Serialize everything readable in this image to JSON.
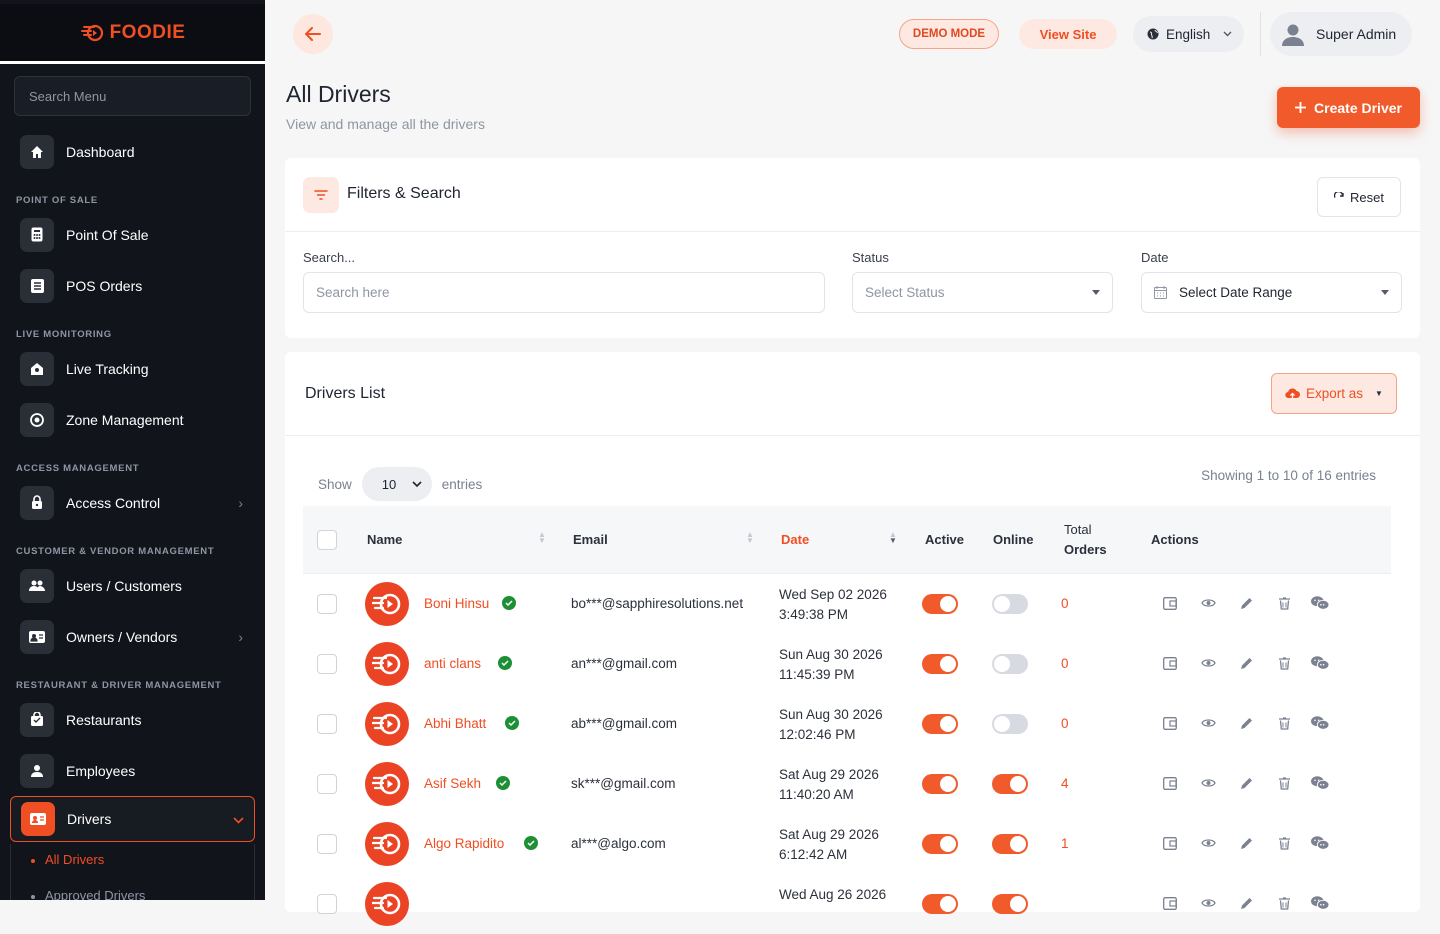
{
  "brand": {
    "name": "FOODIE",
    "color": "#f04e23"
  },
  "sidebar": {
    "search_placeholder": "Search Menu",
    "dashboard": "Dashboard",
    "sections": {
      "pos": "POINT OF SALE",
      "live": "LIVE MONITORING",
      "access": "ACCESS MANAGEMENT",
      "customer": "CUSTOMER & VENDOR MANAGEMENT",
      "restaurant": "RESTAURANT & DRIVER MANAGEMENT"
    },
    "items": {
      "point_of_sale": "Point Of Sale",
      "pos_orders": "POS Orders",
      "live_tracking": "Live Tracking",
      "zone_management": "Zone Management",
      "access_control": "Access Control",
      "users_customers": "Users / Customers",
      "owners_vendors": "Owners / Vendors",
      "restaurants": "Restaurants",
      "employees": "Employees",
      "drivers": "Drivers"
    },
    "drivers_sub": {
      "all": "All Drivers",
      "approved": "Approved Drivers"
    }
  },
  "header": {
    "demo_mode": "DEMO MODE",
    "view_site": "View Site",
    "language": "English",
    "user": "Super Admin"
  },
  "page": {
    "title": "All Drivers",
    "subtitle": "View and manage all the drivers",
    "create_button": "Create Driver"
  },
  "filters": {
    "title": "Filters & Search",
    "reset": "Reset",
    "search_label": "Search...",
    "search_placeholder": "Search here",
    "status_label": "Status",
    "status_placeholder": "Select Status",
    "date_label": "Date",
    "date_value": "Select Date Range"
  },
  "list": {
    "title": "Drivers List",
    "export": "Export as",
    "show": "Show",
    "page_size": "10",
    "entries": "entries",
    "showing": "Showing 1 to 10 of 16 entries",
    "columns": {
      "name": "Name",
      "email": "Email",
      "date": "Date",
      "active": "Active",
      "online": "Online",
      "total_orders_1": "Total",
      "total_orders_2": "Orders",
      "actions": "Actions"
    },
    "rows": [
      {
        "name": "Boni Hinsu",
        "email": "bo***@sapphiresolutions.net",
        "date1": "Wed Sep 02 2026",
        "date2": "3:49:38 PM",
        "active": true,
        "online": false,
        "orders": "0"
      },
      {
        "name": "anti clans",
        "email": "an***@gmail.com",
        "date1": "Sun Aug 30 2026",
        "date2": "11:45:39 PM",
        "active": true,
        "online": false,
        "orders": "0"
      },
      {
        "name": "Abhi Bhatt",
        "email": "ab***@gmail.com",
        "date1": "Sun Aug 30 2026",
        "date2": "12:02:46 PM",
        "active": true,
        "online": false,
        "orders": "0"
      },
      {
        "name": "Asif Sekh",
        "email": "sk***@gmail.com",
        "date1": "Sat Aug 29 2026",
        "date2": "11:40:20 AM",
        "active": true,
        "online": true,
        "orders": "4"
      },
      {
        "name": "Algo Rapidito",
        "email": "al***@algo.com",
        "date1": "Sat Aug 29 2026",
        "date2": "6:12:42 AM",
        "active": true,
        "online": true,
        "orders": "1"
      },
      {
        "name": "",
        "email": "",
        "date1": "Wed Aug 26 2026",
        "date2": "",
        "active": true,
        "online": true,
        "orders": ""
      }
    ]
  }
}
